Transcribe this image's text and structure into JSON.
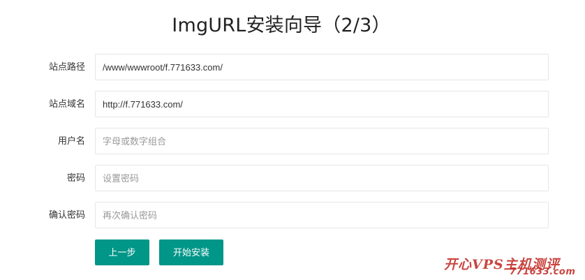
{
  "page": {
    "title": "ImgURL安装向导（2/3）"
  },
  "form": {
    "fields": [
      {
        "label": "站点路径",
        "value": "/www/wwwroot/f.771633.com/",
        "placeholder": ""
      },
      {
        "label": "站点域名",
        "value": "http://f.771633.com/",
        "placeholder": ""
      },
      {
        "label": "用户名",
        "value": "",
        "placeholder": "字母或数字组合"
      },
      {
        "label": "密码",
        "value": "",
        "placeholder": "设置密码"
      },
      {
        "label": "确认密码",
        "value": "",
        "placeholder": "再次确认密码"
      }
    ]
  },
  "buttons": {
    "prev_label": "上一步",
    "start_label": "开始安装"
  },
  "watermark": {
    "line1": "开心VPS主机测评",
    "line2": "771633.com"
  },
  "colors": {
    "accent": "#009688",
    "watermark": "#c0251f",
    "input_border": "#e6e6e6",
    "placeholder": "#999999"
  }
}
